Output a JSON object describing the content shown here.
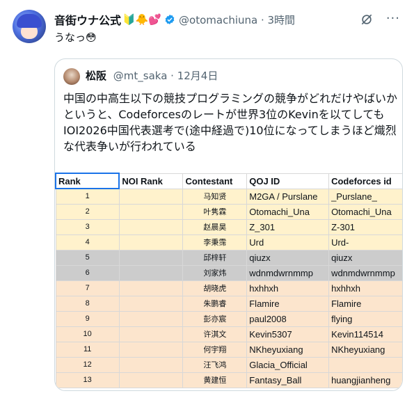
{
  "tweet": {
    "author_name": "音街ウナ公式",
    "author_emojis": "🔰🐥💕",
    "handle_time": "@otomachiuna · 3時間",
    "text": "うなっ😳"
  },
  "quote": {
    "author_name": "松阪",
    "handle_time": "@mt_saka · 12月4日",
    "text": "中国の中高生以下の競技プログラミングの競争がどれだけやばいかというと、Codeforcesのレートが世界3位のKevinを以てしてもIOI2026中国代表選考で(途中経過で)10位になってしまうほど熾烈な代表争いが行われている"
  },
  "table": {
    "headers": [
      "Rank",
      "NOI Rank",
      "Contestant",
      "QOJ ID",
      "Codeforces id"
    ],
    "rows": [
      {
        "rank": "1",
        "noi": "",
        "contestant": "马知贤",
        "qoj": "M2GA / Purslane",
        "cf": "_Purslane_",
        "color": "yellow"
      },
      {
        "rank": "2",
        "noi": "",
        "contestant": "叶隽霖",
        "qoj": "Otomachi_Una",
        "cf": "Otomachi_Una",
        "color": "yellow"
      },
      {
        "rank": "3",
        "noi": "",
        "contestant": "赵晨昊",
        "qoj": "Z_301",
        "cf": "Z-301",
        "color": "yellow"
      },
      {
        "rank": "4",
        "noi": "",
        "contestant": "李秉霈",
        "qoj": "Urd",
        "cf": "Urd-",
        "color": "yellow"
      },
      {
        "rank": "5",
        "noi": "",
        "contestant": "邱梓轩",
        "qoj": "qiuzx",
        "cf": "qiuzx",
        "color": "gray"
      },
      {
        "rank": "6",
        "noi": "",
        "contestant": "刘家炜",
        "qoj": "wdnmdwrnmmp",
        "cf": "wdnmdwrnmmp",
        "color": "gray"
      },
      {
        "rank": "7",
        "noi": "",
        "contestant": "胡晓虎",
        "qoj": "hxhhxh",
        "cf": "hxhhxh",
        "color": "peach"
      },
      {
        "rank": "8",
        "noi": "",
        "contestant": "朱鹏睿",
        "qoj": "Flamire",
        "cf": "Flamire",
        "color": "peach"
      },
      {
        "rank": "9",
        "noi": "",
        "contestant": "彭亦宸",
        "qoj": "paul2008",
        "cf": "flying",
        "color": "peach"
      },
      {
        "rank": "10",
        "noi": "",
        "contestant": "许淇文",
        "qoj": "Kevin5307",
        "cf": "Kevin114514",
        "color": "peach"
      },
      {
        "rank": "11",
        "noi": "",
        "contestant": "何宇翔",
        "qoj": "NKheyuxiang",
        "cf": "NKheyuxiang",
        "color": "peach"
      },
      {
        "rank": "12",
        "noi": "",
        "contestant": "汪飞鸿",
        "qoj": "Glacia_Official",
        "cf": "",
        "color": "peach"
      },
      {
        "rank": "13",
        "noi": "",
        "contestant": "黄建恒",
        "qoj": "Fantasy_Ball",
        "cf": "huangjianheng",
        "color": "peach"
      }
    ]
  },
  "icons": {
    "more": "more-icon",
    "grok": "grok-icon",
    "verified": "verified-badge-icon"
  },
  "colors": {
    "yellow_row": "#fff2cc",
    "gray_row": "#cccccc",
    "peach_row": "#fce5cd",
    "selection": "#1a73e8",
    "verified": "#1d9bf0"
  }
}
